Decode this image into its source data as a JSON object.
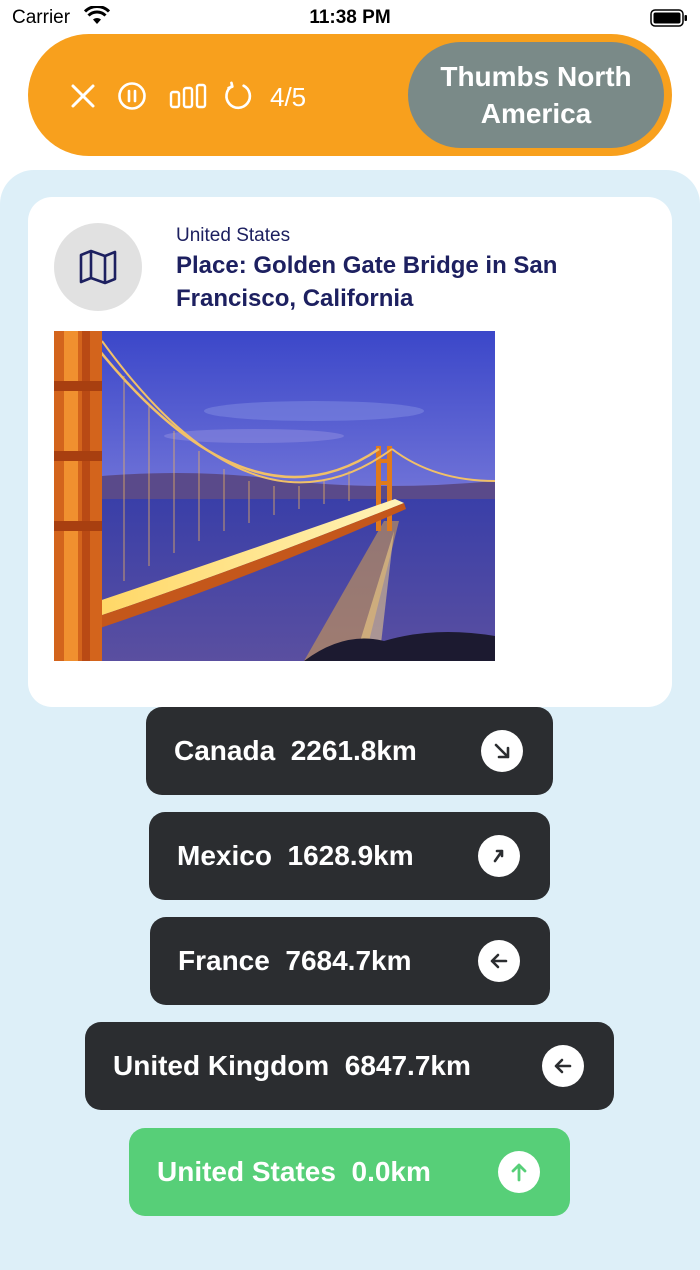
{
  "status_bar": {
    "carrier": "Carrier",
    "time": "11:38 PM"
  },
  "header": {
    "progress": "4/5",
    "mode_label": "Thumbs North America",
    "icons": [
      "close-icon",
      "pause-icon",
      "stats-icon",
      "restart-icon"
    ],
    "accent_color": "#f8a01d"
  },
  "clue": {
    "icon": "map-icon",
    "country": "United States",
    "place": "Place: Golden Gate Bridge in San Francisco, California",
    "photo": "golden-gate-bridge-photo"
  },
  "guesses": [
    {
      "country": "Canada",
      "distance": "2261.8km",
      "direction": "south-east-arrow",
      "correct": false
    },
    {
      "country": "Mexico",
      "distance": "1628.9km",
      "direction": "north-east-arrow",
      "correct": false
    },
    {
      "country": "France",
      "distance": "7684.7km",
      "direction": "west-arrow",
      "correct": false
    },
    {
      "country": "United Kingdom",
      "distance": "6847.7km",
      "direction": "west-arrow",
      "correct": false
    },
    {
      "country": "United States",
      "distance": "0.0km",
      "direction": "north-arrow",
      "correct": true
    }
  ]
}
